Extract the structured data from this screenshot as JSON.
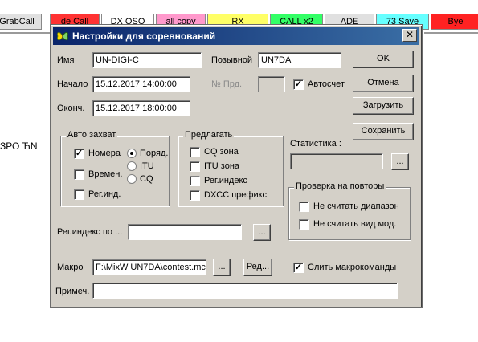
{
  "toolbar": [
    {
      "label": "GrabCall",
      "bg": "#e0e0e0"
    },
    {
      "label": "de Call",
      "bg": "#ff3333"
    },
    {
      "label": "DX QSO",
      "bg": "#ffffff"
    },
    {
      "label": "all copy",
      "bg": "#ff99cc"
    },
    {
      "label": "RX",
      "bg": "#ffff66"
    },
    {
      "label": "CALL x2",
      "bg": "#33ff66"
    },
    {
      "label": "ADE",
      "bg": "#e0e0e0"
    },
    {
      "label": "73 Save",
      "bg": "#66ffff"
    },
    {
      "label": "Bye",
      "bg": "#ff2222"
    }
  ],
  "background_text": "ЗРО ЋN",
  "dialog": {
    "title": "Настройки для соревнований",
    "name_label": "Имя",
    "name_value": "UN-DIGI-C",
    "callsign_label": "Позывной",
    "callsign_value": "UN7DA",
    "start_label": "Начало",
    "start_value": "15.12.2017 14:00:00",
    "end_label": "Оконч.",
    "end_value": "15.12.2017 18:00:00",
    "number_label": "№ Прд.",
    "number_value": "",
    "autocount_label": "Автосчет",
    "autocapture": {
      "title": "Авто захват",
      "numbers": "Номера",
      "times": "Времен.",
      "regindex": "Рег.инд.",
      "order": "Поряд.",
      "itu": "ITU",
      "cq": "CQ"
    },
    "suggest": {
      "title": "Предлагать",
      "cq_zone": "CQ зона",
      "itu_zone": "ITU зона",
      "reg_index": "Рег.индекс",
      "dxcc_prefix": "DXCC префикс"
    },
    "statistics_label": "Статистика :",
    "statistics_value": "",
    "ellipsis": "...",
    "repeats": {
      "title": "Проверка на повторы",
      "ignore_band": "Не считать диапазон",
      "ignore_mode": "Не считать вид мод."
    },
    "regindex_by_label": "Рег.индекс по ...",
    "regindex_by_value": "",
    "macro_label": "Макро",
    "macro_value": "F:\\MixW UN7DA\\contest.mc",
    "edit_label": "Ред...",
    "merge_macros_label": "Слить макрокоманды",
    "note_label": "Примеч.",
    "note_value": "",
    "buttons": {
      "ok": "OK",
      "cancel": "Отмена",
      "load": "Загрузить",
      "save": "Сохранить"
    }
  }
}
